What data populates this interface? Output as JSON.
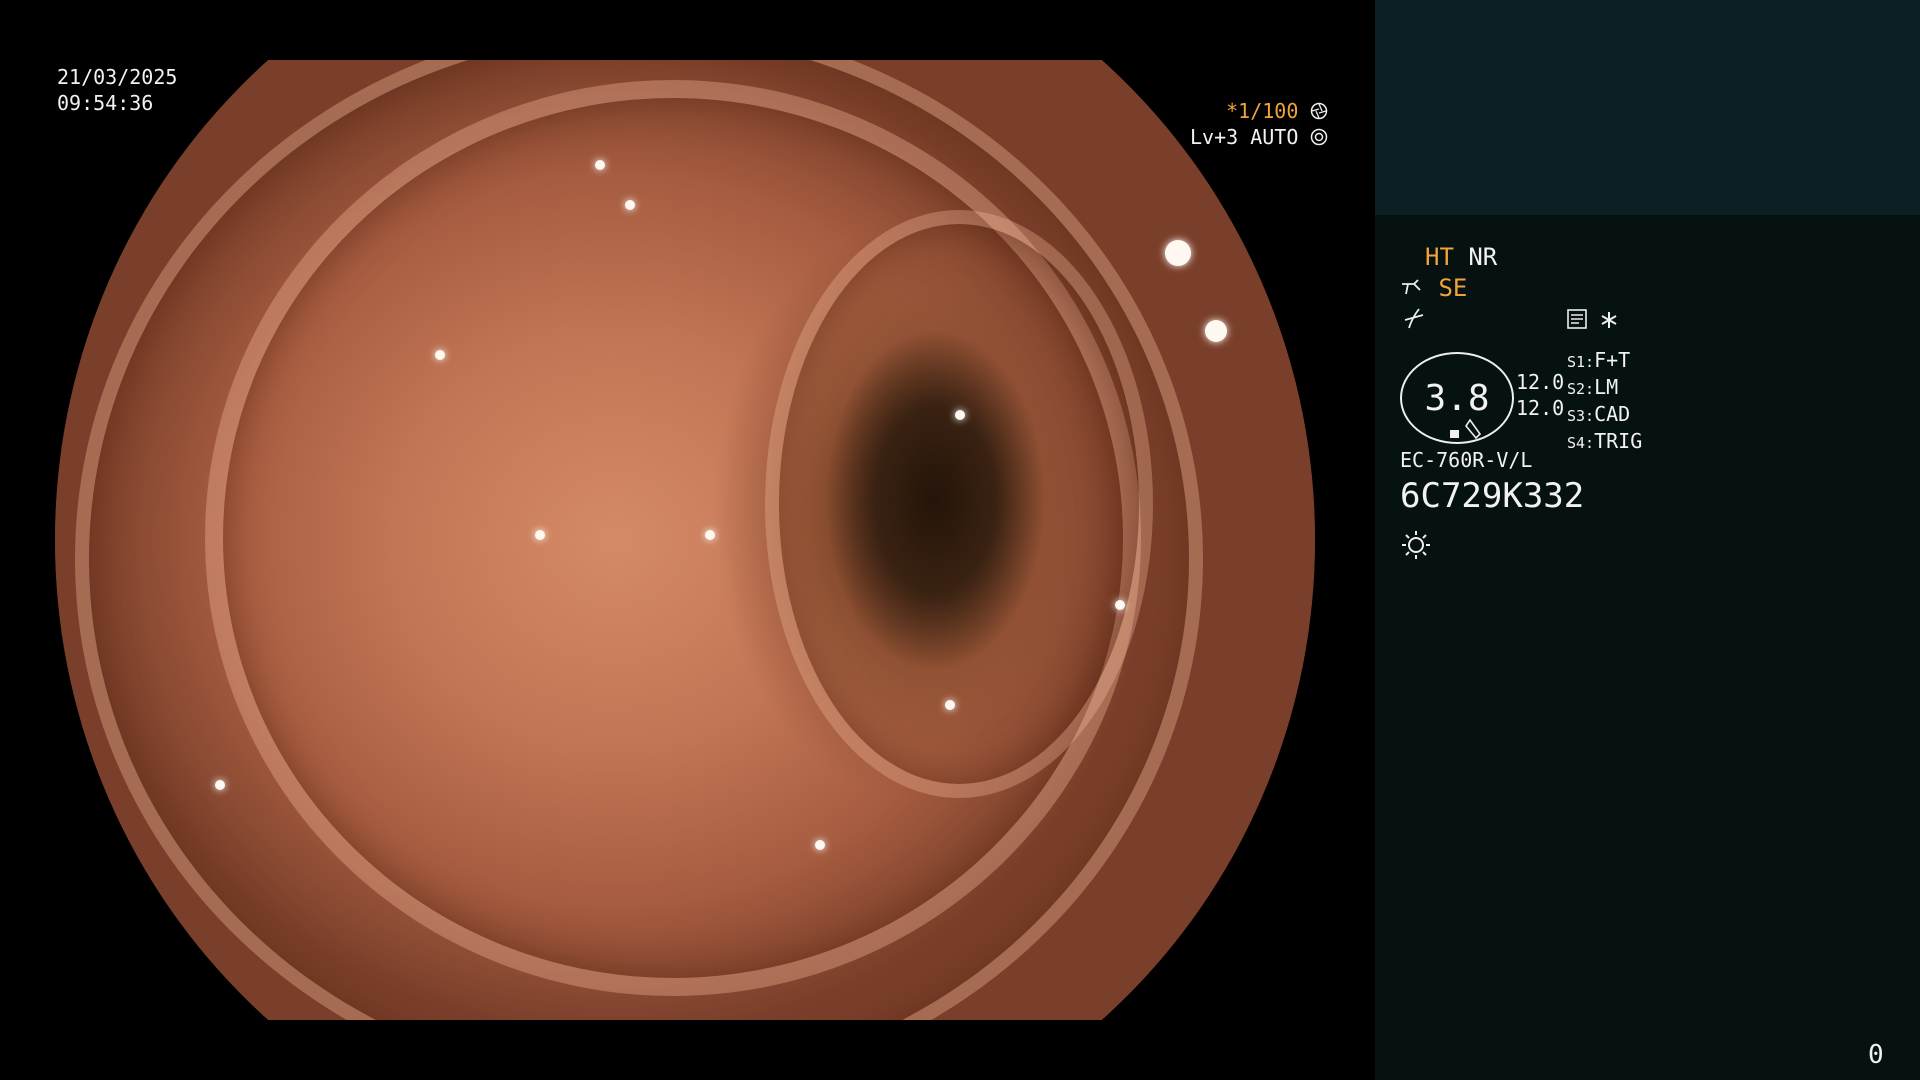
{
  "datetime": {
    "date": "21/03/2025",
    "time": "09:54:36"
  },
  "exposure": {
    "shutter": "*1/100",
    "level": "Lv+3",
    "mode": "AUTO"
  },
  "settings": {
    "ht_label": "HT",
    "nr_label": "NR",
    "se_label": "SE",
    "zoom_value": "3.8",
    "side_top": "12.0",
    "side_bottom": "12.0",
    "s1_key": "S1:",
    "s1_value": "F+T",
    "s2_key": "S2:",
    "s2_value": "LM",
    "s3_key": "S3:",
    "s3_value": "CAD",
    "s4_key": "S4:",
    "s4_value": "TRIG"
  },
  "scope": {
    "model": "EC-760R-V/L",
    "serial": "6C729K332"
  },
  "counter": "0",
  "icons": {
    "shutter": "aperture-icon",
    "auto": "iris-icon",
    "se": "scope-tip-icon",
    "enhance": "slash-curve-icon",
    "memo": "document-icon",
    "star": "asterisk-icon",
    "light": "sun-icon"
  },
  "colors": {
    "accent": "#f0a33a",
    "panel_top": "#0c1f22",
    "panel": "#061111"
  }
}
